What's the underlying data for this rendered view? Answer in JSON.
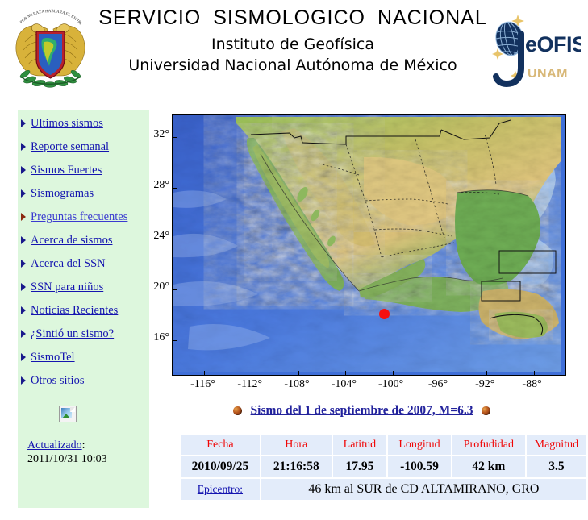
{
  "header": {
    "title_main": "SERVICIO  SISMOLOGICO  NACIONAL",
    "title_sub1": "Instituto de Geofísica",
    "title_sub2": "Universidad Nacional Autónoma de México",
    "left_logo_name": "UNAM coat of arms",
    "right_logo_name": "Geofisica UNAM logo",
    "right_logo_text": "eOFISICA",
    "right_logo_subtext": "UNAM"
  },
  "sidebar": {
    "items": [
      {
        "label": "Ultimos sismos",
        "active": false
      },
      {
        "label": "Reporte semanal",
        "active": false
      },
      {
        "label": "Sismos Fuertes",
        "active": false
      },
      {
        "label": "Sismogramas",
        "active": false
      },
      {
        "label": "Preguntas frecuentes",
        "active": true
      },
      {
        "label": "Acerca de sismos",
        "active": false
      },
      {
        "label": "Acerca del SSN",
        "active": false
      },
      {
        "label": "SSN para niños",
        "active": false
      },
      {
        "label": "Noticias Recientes",
        "active": false
      },
      {
        "label": "¿Sintió un sismo?",
        "active": false
      },
      {
        "label": "SismoTel",
        "active": false
      },
      {
        "label": "Otros sitios",
        "active": false
      }
    ],
    "updated_label": "Actualizado",
    "updated_colon": ":",
    "updated_value": "2011/10/31 10:03",
    "background_color": "#ddf7dd",
    "link_color": "#1414b0"
  },
  "map": {
    "xticks": [
      "-116°",
      "-112°",
      "-108°",
      "-104°",
      "-100°",
      "-96°",
      "-92°",
      "-88°"
    ],
    "xtick_values": [
      -116,
      -112,
      -108,
      -104,
      -100,
      -96,
      -92,
      -88
    ],
    "yticks": [
      "32°",
      "28°",
      "24°",
      "20°",
      "16°"
    ],
    "ytick_values": [
      32,
      28,
      24,
      20,
      16
    ],
    "xlim": [
      -118.5,
      -85.5
    ],
    "ylim": [
      13.4,
      33.6
    ],
    "epicenter_marker": {
      "name": "epicenter-marker",
      "color": "#f51010",
      "lon": -100.59,
      "lat": 17.95
    }
  },
  "event": {
    "title": "Sismo del 1 de septiembre de 2007, M=6.3",
    "icon_name": "quake-globe-icon",
    "title_color": "#22229c"
  },
  "table": {
    "headers": [
      "Fecha",
      "Hora",
      "Latitud",
      "Longitud",
      "Profudidad",
      "Magnitud"
    ],
    "header_color": "#f00505",
    "cell_background": "#e3ecfa",
    "row": [
      "2010/09/25",
      "21:16:58",
      "17.95",
      "-100.59",
      "42 km",
      "3.5"
    ],
    "epicenter_label": "Epicentro:",
    "epicenter_value": "46 km al SUR de CD ALTAMIRANO, GRO"
  }
}
